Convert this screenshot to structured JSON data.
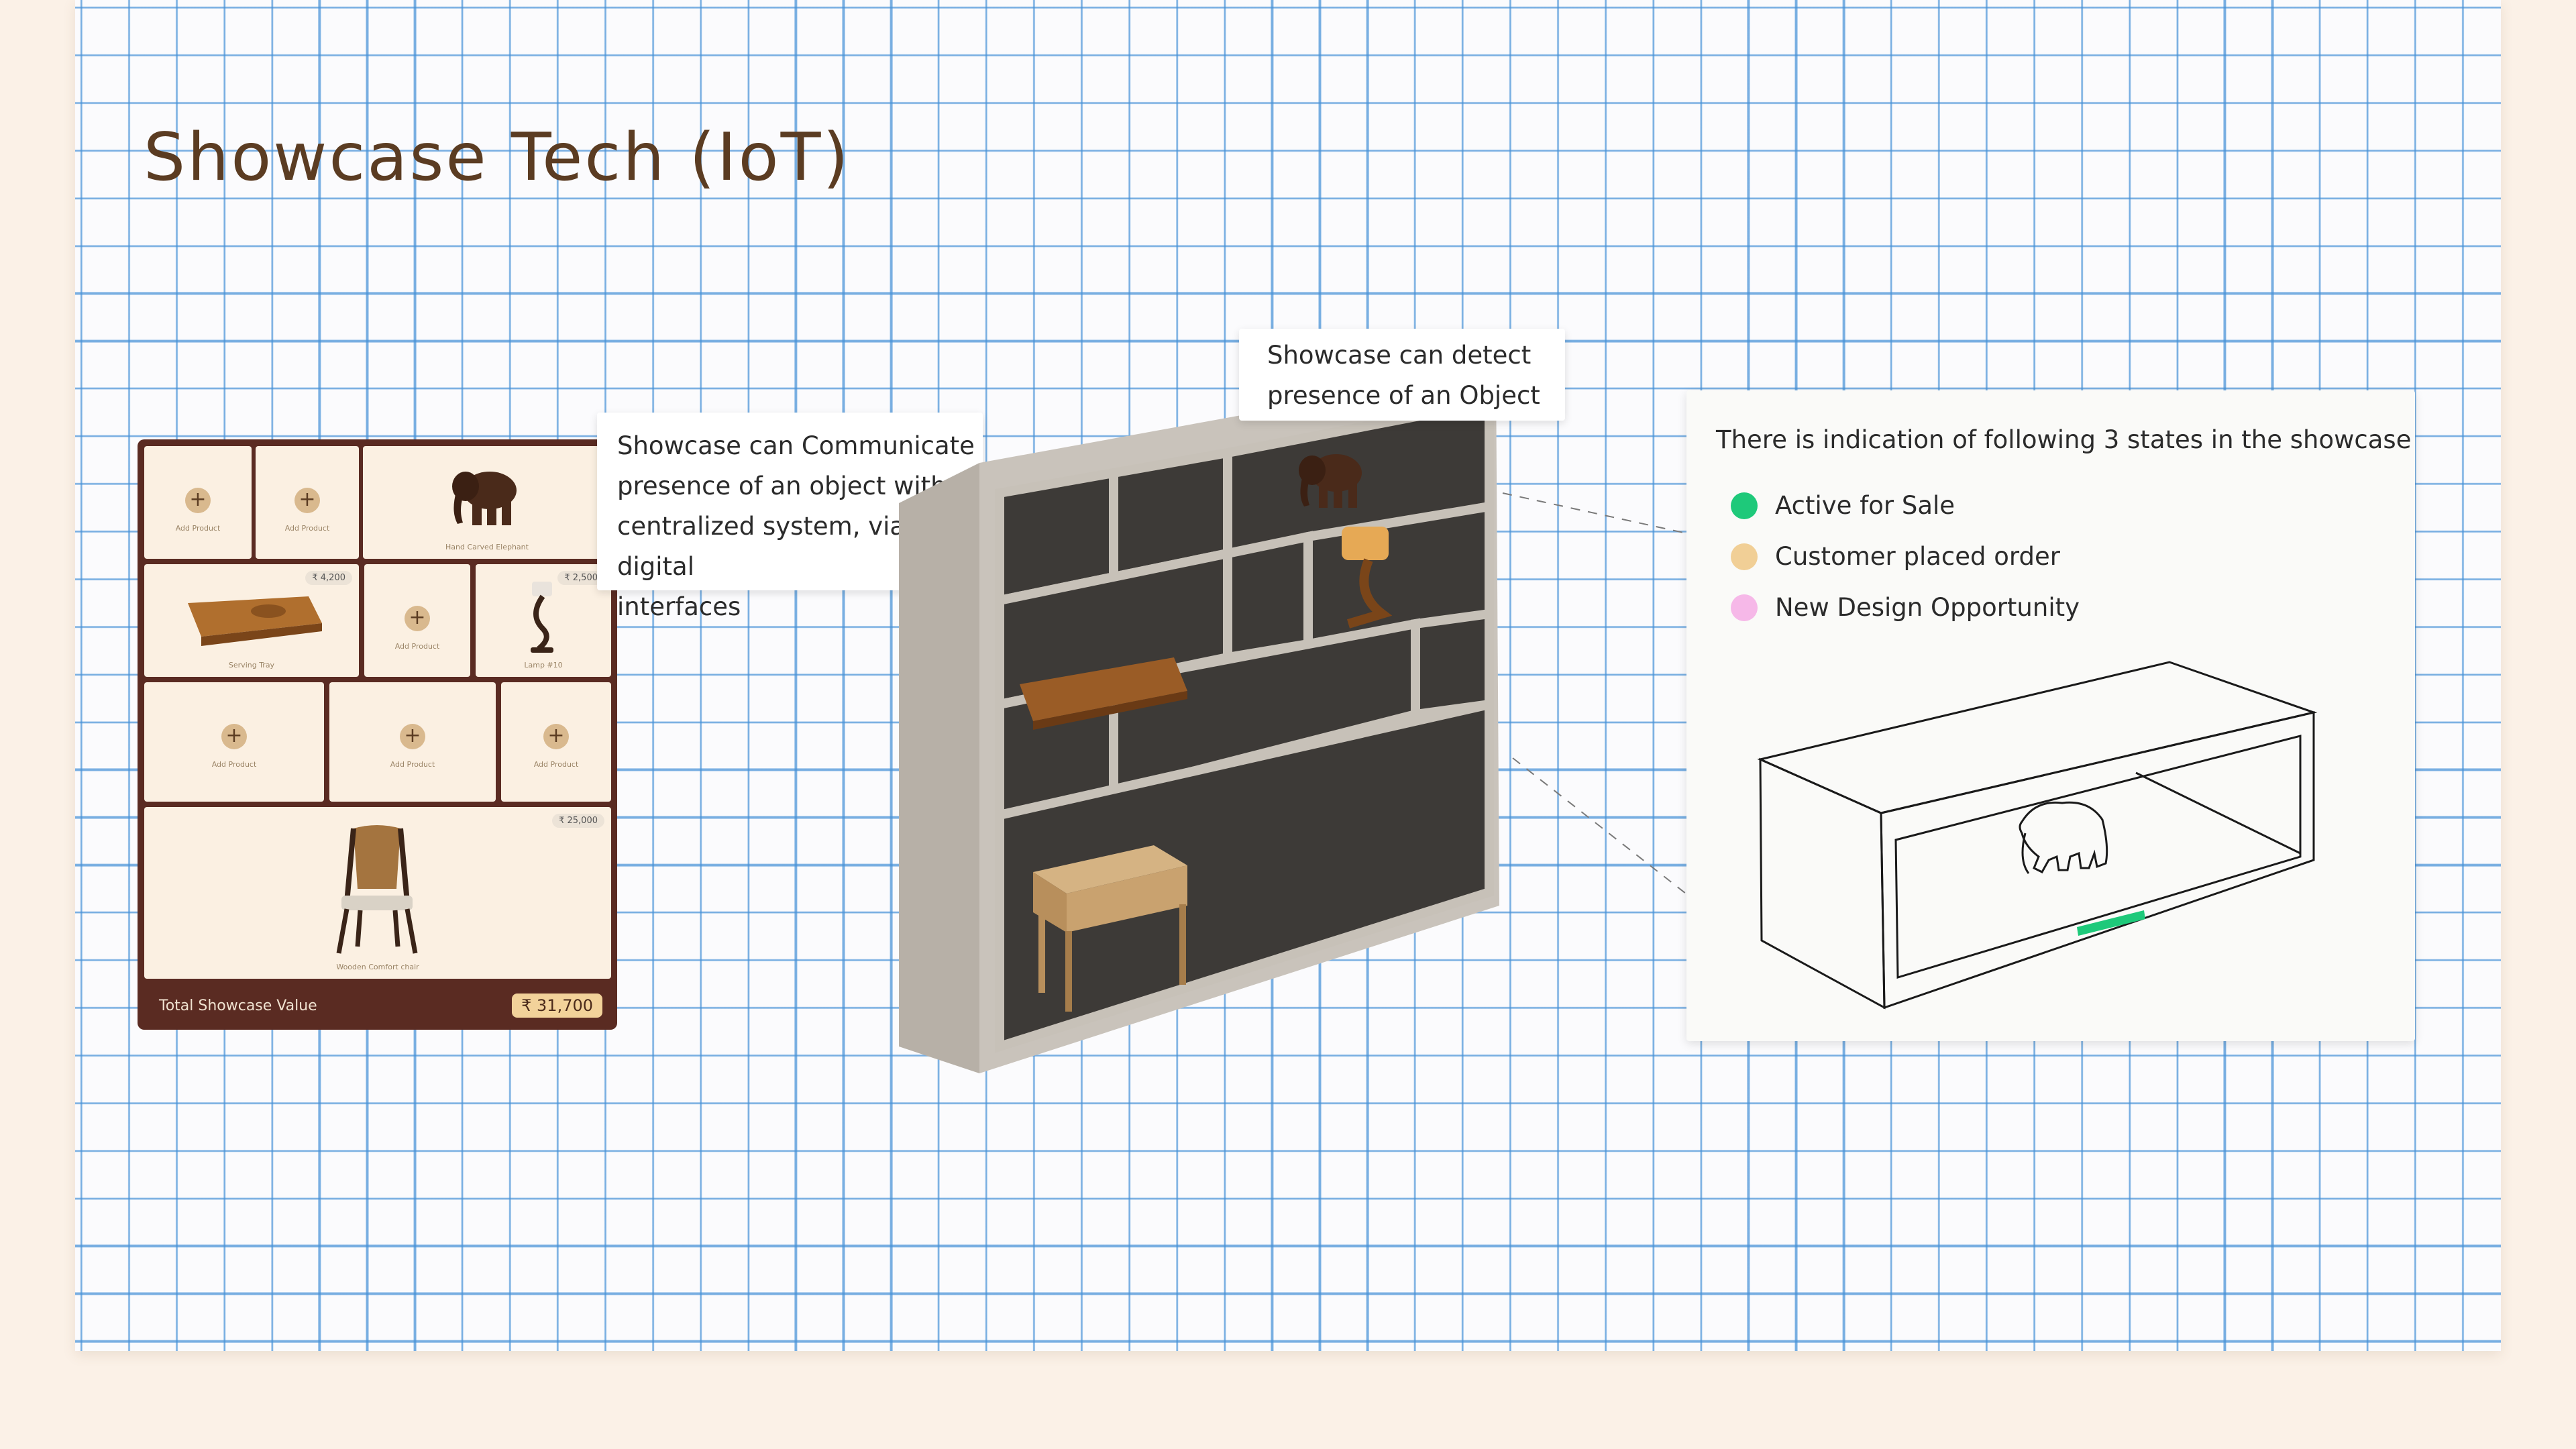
{
  "title": "Showcase Tech (IoT)",
  "dashboard": {
    "cards": [
      {
        "label": "Add Product"
      },
      {
        "label": "Add Product"
      },
      {
        "label": "Hand Carved Elephant"
      },
      {
        "label": "Serving Tray",
        "price": "₹ 4,200"
      },
      {
        "label": "Add Product"
      },
      {
        "label": "Lamp #10",
        "price": "₹ 2,500"
      },
      {
        "label": "Add Product"
      },
      {
        "label": "Add Product"
      },
      {
        "label": "Add Product"
      },
      {
        "label": "Wooden Comfort chair",
        "price": "₹ 25,000"
      }
    ],
    "plus_glyph": "+",
    "footer_label": "Total Showcase Value",
    "footer_value": "₹ 31,700"
  },
  "callouts": {
    "communicate": [
      "Showcase can Communicate",
      "presence of an object with a",
      "centralized system, via digital",
      "interfaces"
    ],
    "detect": [
      "Showcase can detect",
      "presence of an Object"
    ]
  },
  "states_panel": {
    "heading": "There is indication of following 3 states in the showcase",
    "states": [
      {
        "label": "Active for Sale",
        "color": "#1ec97a"
      },
      {
        "label": "Customer placed order",
        "color": "#f1cf96"
      },
      {
        "label": "New Design Opportunity",
        "color": "#f6b8e8"
      }
    ],
    "sensor_color": "#1ec97a"
  },
  "colors": {
    "title": "#5b3c22",
    "dashboard_bg": "#5a2b22",
    "card_bg": "#fbf0e2",
    "grid_line": "#4691d7"
  }
}
